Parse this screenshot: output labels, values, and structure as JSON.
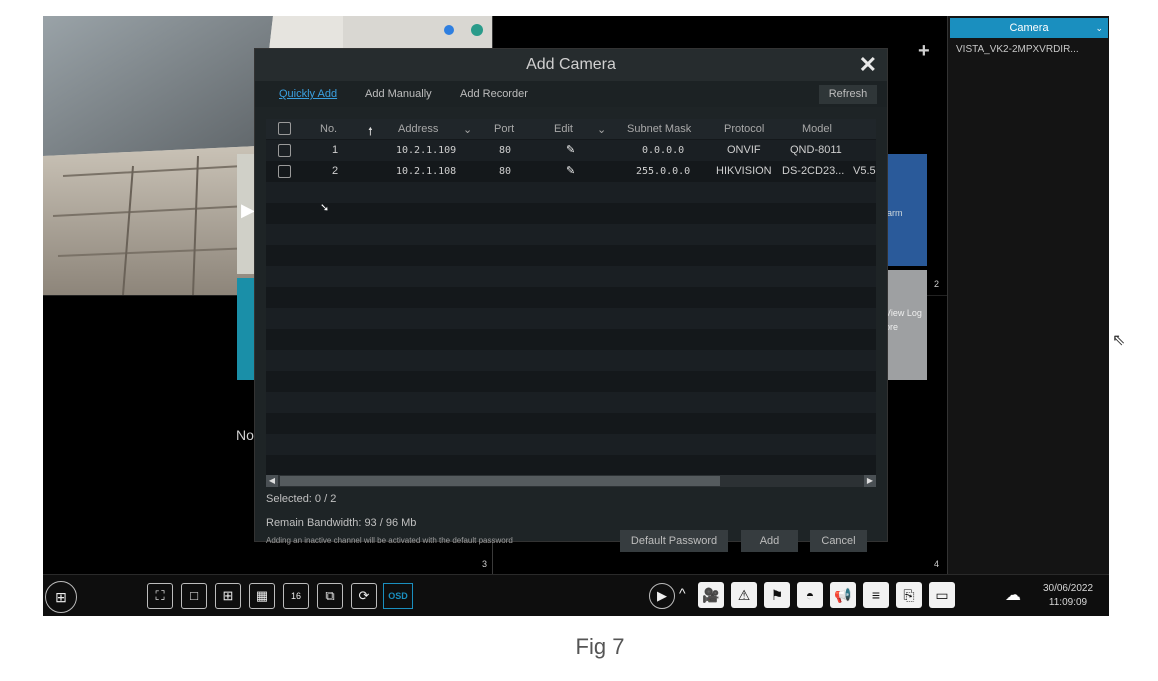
{
  "right_panel": {
    "camera_dropdown": "Camera",
    "camera_item": "VISTA_VK2-2MPXVRDIR..."
  },
  "dialog": {
    "title": "Add Camera",
    "close_icon": "close-icon",
    "tabs": [
      "Quickly Add",
      "Add Manually",
      "Add Recorder"
    ],
    "refresh": "Refresh",
    "columns": [
      "No.",
      "Address",
      "Port",
      "Edit",
      "Subnet Mask",
      "Protocol",
      "Model"
    ],
    "rows": [
      {
        "no": "1",
        "address": "10.2.1.109",
        "port": "80",
        "mask": "0.0.0.0",
        "protocol": "ONVIF",
        "model": "QND-8011",
        "version": ""
      },
      {
        "no": "2",
        "address": "10.2.1.108",
        "port": "80",
        "mask": "255.0.0.0",
        "protocol": "HIKVISION",
        "model": "DS-2CD23...",
        "version": "V5.5"
      }
    ],
    "selected": "Selected: 0 / 2",
    "bandwidth": "Remain Bandwidth: 93 / 96 Mb",
    "note": "Adding an inactive channel will be activated with the default password",
    "default_password": "Default Password",
    "add": "Add",
    "cancel": "Cancel"
  },
  "background": {
    "ghost_alarm": "larm",
    "ghost_view_log": "View Log",
    "ghost_more": "ore",
    "ghost_no": "No",
    "channel_numbers": [
      "2",
      "3",
      "4"
    ]
  },
  "taskbar": {
    "osd": "OSD",
    "date": "30/06/2022",
    "time": "11:09:09"
  },
  "caption": "Fig 7"
}
